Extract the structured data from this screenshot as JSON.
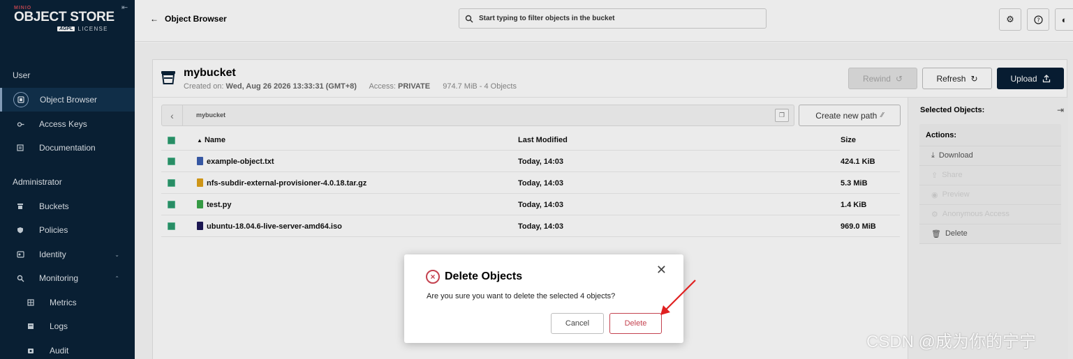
{
  "brand": {
    "small": "MINIO",
    "name": "OBJECT STORE",
    "license_badge": "AGPL",
    "license": "LICENSE"
  },
  "sidebar": {
    "user_label": "User",
    "user_items": [
      {
        "label": "Object Browser",
        "icon": "object-browser-icon",
        "active": true
      },
      {
        "label": "Access Keys",
        "icon": "key-icon"
      },
      {
        "label": "Documentation",
        "icon": "docs-icon"
      }
    ],
    "admin_label": "Administrator",
    "admin_items": [
      {
        "label": "Buckets",
        "icon": "bucket-icon"
      },
      {
        "label": "Policies",
        "icon": "shield-icon"
      },
      {
        "label": "Identity",
        "icon": "identity-icon",
        "chevron": "down"
      },
      {
        "label": "Monitoring",
        "icon": "search-icon",
        "chevron": "up"
      },
      {
        "label": "Metrics",
        "icon": "metrics-icon",
        "sub": true
      },
      {
        "label": "Logs",
        "icon": "logs-icon",
        "sub": true
      },
      {
        "label": "Audit",
        "icon": "audit-icon",
        "sub": true
      }
    ]
  },
  "topbar": {
    "back_label": "Object Browser",
    "search_placeholder": "Start typing to filter objects in the bucket"
  },
  "bucket": {
    "name": "mybucket",
    "created_label": "Created on:",
    "created_value": "Wed, Aug 26 2026 13:33:31 (GMT+8)",
    "access_label": "Access:",
    "access_value": "PRIVATE",
    "summary": "974.7 MiB - 4 Objects",
    "rewind_label": "Rewind",
    "refresh_label": "Refresh",
    "upload_label": "Upload"
  },
  "path": {
    "crumb": "mybucket",
    "new_path_label": "Create new path"
  },
  "table": {
    "headers": {
      "name": "Name",
      "modified": "Last Modified",
      "size": "Size"
    },
    "rows": [
      {
        "name": "example-object.txt",
        "modified": "Today, 14:03",
        "size": "424.1 KiB",
        "color": "#3b5fb0"
      },
      {
        "name": "nfs-subdir-external-provisioner-4.0.18.tar.gz",
        "modified": "Today, 14:03",
        "size": "5.3 MiB",
        "color": "#e0a21a"
      },
      {
        "name": "test.py",
        "modified": "Today, 14:03",
        "size": "1.4 KiB",
        "color": "#3aa84a"
      },
      {
        "name": "ubuntu-18.04.6-live-server-amd64.iso",
        "modified": "Today, 14:03",
        "size": "969.0 MiB",
        "color": "#1f1a5a"
      }
    ]
  },
  "selected": {
    "title": "Selected Objects:",
    "actions_label": "Actions:",
    "download": "Download",
    "share": "Share",
    "preview": "Preview",
    "anonymous": "Anonymous Access",
    "delete": "Delete"
  },
  "modal": {
    "title": "Delete Objects",
    "message": "Are you sure you want to delete the selected 4 objects?",
    "cancel": "Cancel",
    "delete": "Delete"
  },
  "watermark": "CSDN @成为你的宁宁",
  "colors": {
    "sidebar_bg": "#0a2238",
    "primary": "#081f36",
    "danger": "#c4424f",
    "checkbox": "#2c9a6e"
  }
}
